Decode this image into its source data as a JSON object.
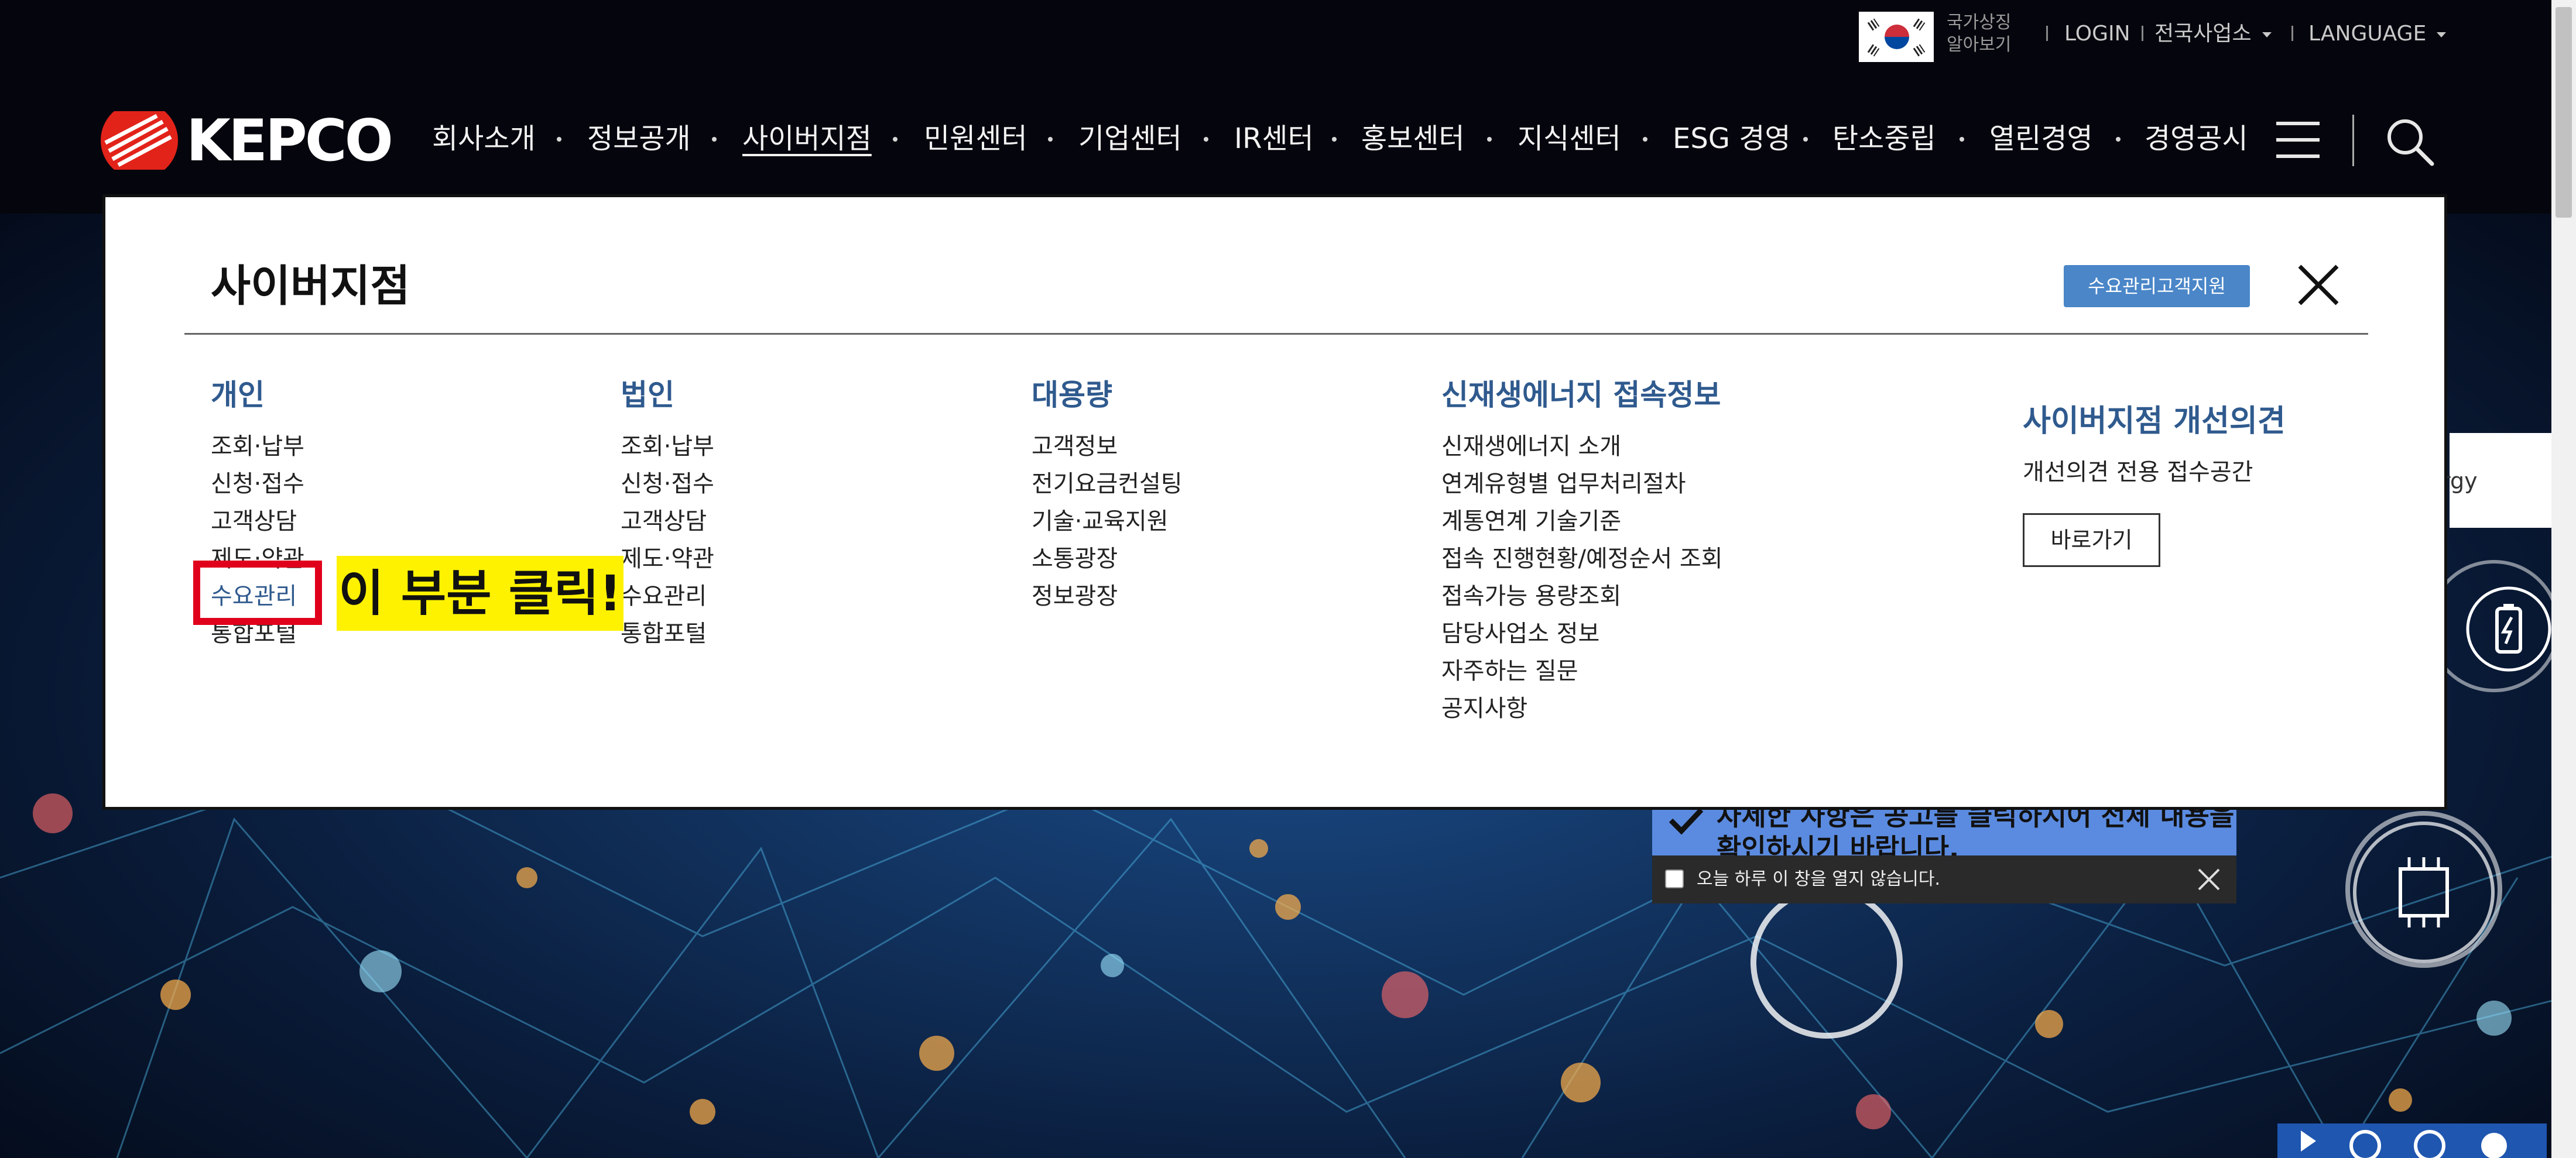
{
  "utility": {
    "symbol_line1": "국가상징",
    "symbol_line2": "알아보기",
    "login": "LOGIN",
    "offices": "전국사업소",
    "language": "LANGUAGE"
  },
  "nav": {
    "logo_alt": "KEPCO",
    "items": [
      "회사소개",
      "정보공개",
      "사이버지점",
      "민원센터",
      "기업센터",
      "IR센터",
      "홍보센터",
      "지식센터",
      "ESG 경영",
      "탄소중립",
      "열린경영",
      "경영공시"
    ],
    "active_index": 2
  },
  "panel": {
    "title": "사이버지점",
    "support_button": "수요관리고객지원",
    "columns": [
      {
        "heading": "개인",
        "items": [
          "조회·납부",
          "신청·접수",
          "고객상담",
          "제도·약관",
          "수요관리",
          "통합포털"
        ]
      },
      {
        "heading": "법인",
        "items": [
          "조회·납부",
          "신청·접수",
          "고객상담",
          "제도·약관",
          "수요관리",
          "통합포털"
        ]
      },
      {
        "heading": "대용량",
        "items": [
          "고객정보",
          "전기요금컨설팅",
          "기술·교육지원",
          "소통광장",
          "정보광장"
        ]
      },
      {
        "heading": "신재생에너지 접속정보",
        "items": [
          "신재생에너지 소개",
          "연계유형별 업무처리절차",
          "계통연계 기술기준",
          "접속 진행현황/예정순서 조회",
          "접속가능 용량조회",
          "담당사업소 정보",
          "자주하는 질문",
          "공지사항"
        ]
      }
    ],
    "improve": {
      "title": "사이버지점 개선의견",
      "desc": "개선의견 전용 접수공간",
      "button": "바로가기"
    }
  },
  "annotation": {
    "callout": "이 부분 클릭!"
  },
  "popup": {
    "line1": "자세한 사항은 공고를 클릭하시어 전체 내용을",
    "line2": "확인하시기 바랍니다.",
    "checkbox_label": "오늘 하루 이 창을 열지 않습니다."
  },
  "side": {
    "card_text": "rgy"
  },
  "colors": {
    "accent_blue": "#2f5a8e",
    "support_button": "#4a86c8",
    "highlight_red": "#e0001c",
    "callout_yellow": "#fff200"
  }
}
